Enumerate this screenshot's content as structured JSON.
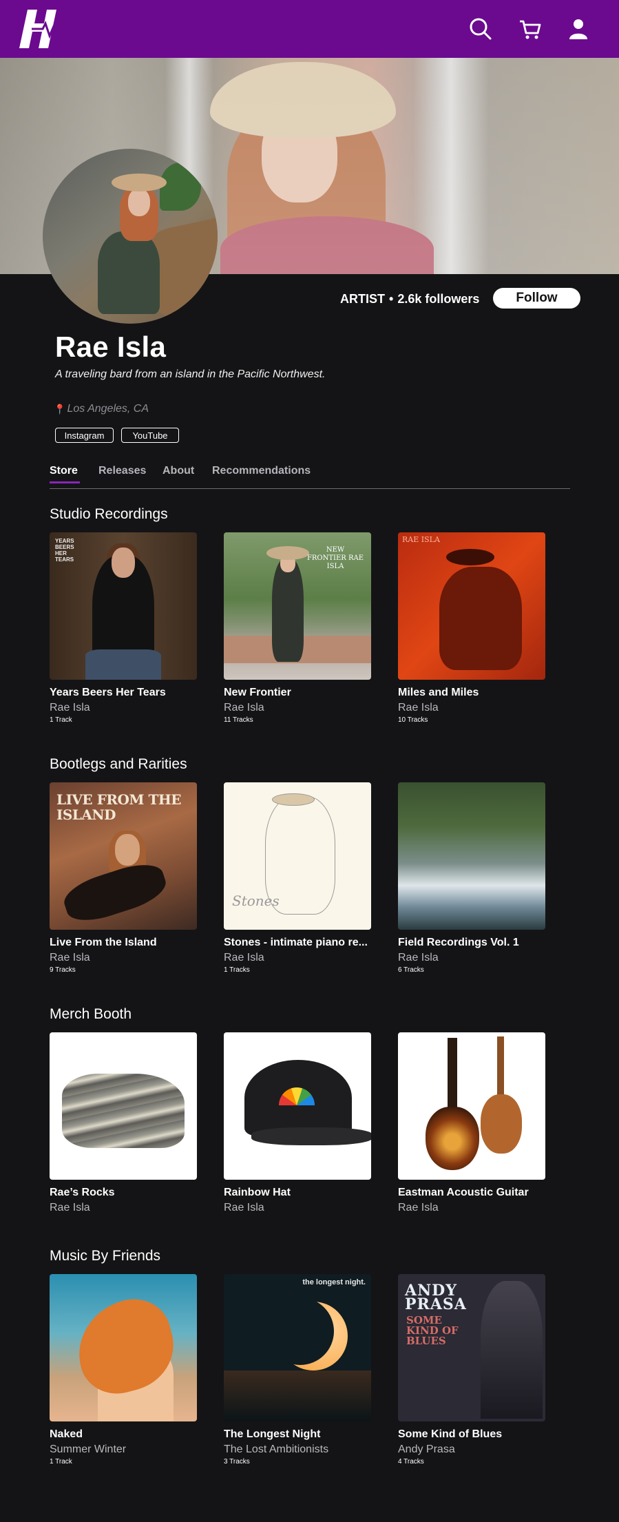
{
  "header": {
    "logo_icon": "h-logo-icon",
    "icons": [
      "search-icon",
      "cart-icon",
      "user-icon"
    ],
    "brand_color": "#6b0a8f"
  },
  "profile": {
    "role": "ARTIST",
    "followers": "2.6k followers",
    "follow_label": "Follow",
    "name": "Rae Isla",
    "tagline": "A traveling bard from an island in the Pacific Northwest.",
    "location": "Los Angeles, CA",
    "links": [
      "Instagram",
      "YouTube"
    ]
  },
  "tabs": [
    "Store",
    "Releases",
    "About",
    "Recommendations"
  ],
  "active_tab": "Store",
  "sections": [
    {
      "title": "Studio Recordings",
      "items": [
        {
          "title": "Years Beers Her Tears",
          "artist": "Rae Isla",
          "tracks": "1 Track",
          "cover_text": "YEARS BEERS HER TEARS"
        },
        {
          "title": "New Frontier",
          "artist": "Rae Isla",
          "tracks": "11 Tracks",
          "cover_text": "NEW FRONTIER RAE ISLA"
        },
        {
          "title": "Miles and Miles",
          "artist": "Rae Isla",
          "tracks": "10 Tracks",
          "cover_text": "RAE ISLA"
        }
      ]
    },
    {
      "title": "Bootlegs and Rarities",
      "items": [
        {
          "title": "Live From the Island",
          "artist": "Rae Isla",
          "tracks": "9 Tracks",
          "cover_text": "LIVE FROM THE ISLAND"
        },
        {
          "title": "Stones - intimate piano re...",
          "artist": "Rae Isla",
          "tracks": "1 Tracks",
          "cover_text": "Stones"
        },
        {
          "title": "Field Recordings Vol. 1",
          "artist": "Rae Isla",
          "tracks": "6 Tracks"
        }
      ]
    },
    {
      "title": "Merch Booth",
      "items": [
        {
          "title": "Rae’s Rocks",
          "artist": "Rae Isla"
        },
        {
          "title": "Rainbow Hat",
          "artist": "Rae Isla"
        },
        {
          "title": "Eastman Acoustic Guitar",
          "artist": "Rae Isla"
        }
      ]
    },
    {
      "title": "Music By Friends",
      "items": [
        {
          "title": "Naked",
          "artist": "Summer Winter",
          "tracks": "1 Track"
        },
        {
          "title": "The Longest Night",
          "artist": "The Lost Ambitionists",
          "tracks": "3 Tracks",
          "cover_text": "the longest night."
        },
        {
          "title": "Some Kind of Blues",
          "artist": "Andy Prasa",
          "tracks": "4 Tracks",
          "cover_text": "ANDY PRASA",
          "cover_subtext": "SOME KIND OF BLUES"
        }
      ]
    }
  ]
}
